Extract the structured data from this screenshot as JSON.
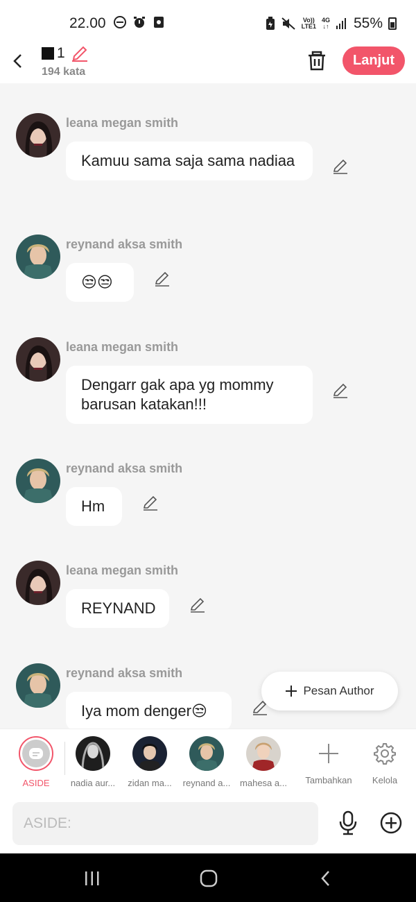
{
  "status": {
    "time": "22.00",
    "network_top": "Vo))",
    "network_bottom": "LTE1",
    "gen_top": "4G",
    "gen_bottom": "↓↑",
    "battery": "55%"
  },
  "header": {
    "title_number": "1",
    "word_count": "194 kata",
    "next_label": "Lanjut"
  },
  "messages": [
    {
      "sender": "leana megan smith",
      "text": "Kamuu sama saja sama nadiaa"
    },
    {
      "sender": "reynand aksa smith",
      "text": "😒😒"
    },
    {
      "sender": "leana megan smith",
      "text": "Dengarr gak apa yg mommy barusan katakan!!!"
    },
    {
      "sender": "reynand aksa smith",
      "text": "Hm"
    },
    {
      "sender": "leana megan smith",
      "text": "REYNAND"
    },
    {
      "sender": "reynand aksa smith",
      "text": "Iya mom denger😒"
    }
  ],
  "pesan_author": "Pesan Author",
  "characters": [
    {
      "label": "ASIDE"
    },
    {
      "label": "nadia aur..."
    },
    {
      "label": "zidan ma..."
    },
    {
      "label": "reynand a..."
    },
    {
      "label": "mahesa a..."
    },
    {
      "label": "Tambahkan"
    },
    {
      "label": "Kelola"
    }
  ],
  "input": {
    "placeholder": "ASIDE:"
  },
  "colors": {
    "accent": "#f2556a",
    "bubble": "#ffffff",
    "background": "#f5f5f5"
  }
}
